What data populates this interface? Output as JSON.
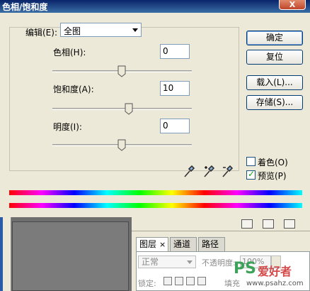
{
  "window": {
    "title": "色相/饱和度",
    "close_label": "X"
  },
  "edit": {
    "label": "编辑(E):",
    "value": "全图"
  },
  "sliders": [
    {
      "label": "色相(H):",
      "value": "0"
    },
    {
      "label": "饱和度(A):",
      "value": "10"
    },
    {
      "label": "明度(I):",
      "value": "0"
    }
  ],
  "buttons": {
    "ok": "确定",
    "reset": "复位",
    "load": "载入(L)...",
    "save": "存储(S)..."
  },
  "checkboxes": {
    "colorize": {
      "label": "着色(O)",
      "checked": false
    },
    "preview": {
      "label": "预览(P)",
      "checked": true
    }
  },
  "layers_panel": {
    "tabs": [
      "图层",
      "通道",
      "路径"
    ],
    "tab_close": "×",
    "blend_mode": "正常",
    "opacity_label": "不透明度:",
    "opacity_value": "100%",
    "lock_label": "锁定:",
    "fill_label": "填充"
  },
  "watermark": {
    "brand": "PS",
    "text": "爱好者",
    "url": "www.psahz.com"
  }
}
